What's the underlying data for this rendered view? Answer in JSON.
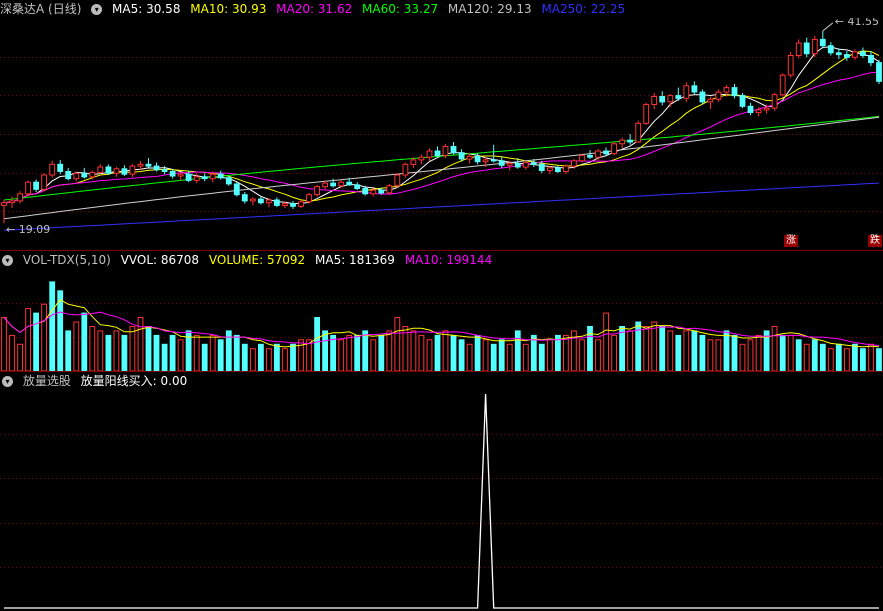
{
  "price_panel": {
    "title": "深桑达A (日线)",
    "indicators": [
      {
        "label": "MA5: 30.58",
        "color": "#ffffff"
      },
      {
        "label": "MA10: 30.93",
        "color": "#ffff00"
      },
      {
        "label": "MA20: 31.62",
        "color": "#ff00ff"
      },
      {
        "label": "MA60: 33.27",
        "color": "#00ff00"
      },
      {
        "label": "MA120: 29.13",
        "color": "#c0c0c0"
      },
      {
        "label": "MA250: 22.25",
        "color": "#3030ff"
      }
    ],
    "high_label": "41.55",
    "low_label": "19.09",
    "tag_rise": "涨",
    "tag_fall": "跌",
    "colors": {
      "up": "#ff3232",
      "down": "#54ffff"
    }
  },
  "volume_panel": {
    "title": "VOL-TDX(5,10)",
    "indicators": [
      {
        "label": "VVOL: 86708",
        "color": "#c0c0c0"
      },
      {
        "label": "VOLUME: 57092",
        "color": "#ffff00"
      },
      {
        "label": "MA5: 181369",
        "color": "#ffffff"
      },
      {
        "label": "MA10: 199144",
        "color": "#ff00ff"
      }
    ]
  },
  "signal_panel": {
    "title": "放量选股",
    "indicators": [
      {
        "label": "放量阳线买入: 0.00",
        "color": "#ffffff"
      }
    ]
  },
  "chart_data": [
    {
      "type": "candlestick",
      "ylim": [
        17,
        43
      ],
      "candles": [
        [
          22.0,
          22.6,
          20.0,
          22.3
        ],
        [
          22.3,
          23.0,
          21.7,
          22.5
        ],
        [
          22.5,
          23.6,
          22.2,
          23.3
        ],
        [
          23.3,
          24.8,
          23.0,
          24.6
        ],
        [
          24.6,
          24.9,
          23.5,
          23.8
        ],
        [
          23.8,
          25.6,
          23.6,
          25.4
        ],
        [
          25.4,
          27.0,
          25.1,
          26.6
        ],
        [
          26.6,
          27.1,
          25.5,
          25.8
        ],
        [
          25.8,
          26.2,
          24.8,
          25.0
        ],
        [
          25.0,
          25.8,
          24.7,
          25.6
        ],
        [
          25.6,
          26.2,
          25.0,
          25.2
        ],
        [
          25.2,
          25.9,
          24.9,
          25.7
        ],
        [
          25.7,
          26.6,
          25.5,
          26.3
        ],
        [
          26.3,
          26.6,
          25.4,
          25.6
        ],
        [
          25.6,
          26.3,
          25.2,
          26.1
        ],
        [
          26.1,
          26.5,
          25.3,
          25.5
        ],
        [
          25.5,
          26.6,
          25.2,
          26.4
        ],
        [
          26.4,
          27.0,
          26.0,
          26.6
        ],
        [
          26.6,
          27.3,
          26.2,
          26.4
        ],
        [
          26.4,
          26.8,
          25.8,
          26.0
        ],
        [
          26.0,
          26.4,
          25.5,
          25.8
        ],
        [
          25.8,
          26.1,
          25.0,
          25.3
        ],
        [
          25.3,
          25.7,
          24.8,
          25.5
        ],
        [
          25.5,
          25.9,
          24.6,
          24.8
        ],
        [
          24.8,
          25.6,
          24.5,
          25.2
        ],
        [
          25.2,
          25.6,
          24.7,
          25.0
        ],
        [
          25.0,
          25.8,
          24.6,
          25.5
        ],
        [
          25.5,
          25.9,
          24.9,
          25.1
        ],
        [
          25.1,
          25.3,
          24.2,
          24.4
        ],
        [
          24.4,
          24.6,
          23.0,
          23.2
        ],
        [
          23.2,
          23.5,
          22.2,
          22.5
        ],
        [
          22.5,
          22.9,
          22.0,
          22.7
        ],
        [
          22.7,
          23.0,
          22.1,
          22.3
        ],
        [
          22.3,
          22.8,
          21.8,
          22.6
        ],
        [
          22.6,
          22.9,
          21.8,
          22.0
        ],
        [
          22.0,
          22.4,
          21.7,
          22.2
        ],
        [
          22.2,
          22.5,
          21.6,
          21.9
        ],
        [
          21.9,
          22.6,
          21.7,
          22.4
        ],
        [
          22.4,
          23.4,
          22.2,
          23.2
        ],
        [
          23.2,
          24.3,
          23.0,
          24.1
        ],
        [
          24.1,
          24.8,
          23.8,
          24.5
        ],
        [
          24.5,
          25.0,
          24.0,
          24.2
        ],
        [
          24.2,
          24.8,
          24.0,
          24.6
        ],
        [
          24.6,
          25.1,
          24.2,
          24.3
        ],
        [
          24.3,
          24.6,
          23.7,
          23.9
        ],
        [
          23.9,
          24.2,
          23.1,
          23.3
        ],
        [
          23.3,
          23.9,
          23.0,
          23.7
        ],
        [
          23.7,
          24.0,
          23.2,
          23.4
        ],
        [
          23.4,
          24.4,
          23.2,
          24.2
        ],
        [
          24.2,
          25.6,
          24.0,
          25.4
        ],
        [
          25.4,
          26.8,
          25.1,
          26.6
        ],
        [
          26.6,
          27.4,
          26.2,
          27.1
        ],
        [
          27.1,
          27.7,
          26.6,
          27.4
        ],
        [
          27.4,
          28.4,
          27.0,
          28.1
        ],
        [
          28.1,
          28.6,
          27.3,
          27.6
        ],
        [
          27.6,
          28.9,
          27.3,
          28.6
        ],
        [
          28.6,
          29.1,
          27.7,
          27.9
        ],
        [
          27.9,
          28.3,
          26.9,
          27.2
        ],
        [
          27.2,
          27.9,
          26.7,
          27.5
        ],
        [
          27.5,
          27.8,
          26.6,
          26.9
        ],
        [
          26.9,
          27.4,
          26.3,
          27.1
        ],
        [
          27.1,
          28.8,
          26.8,
          27.0
        ],
        [
          27.0,
          27.5,
          26.2,
          26.5
        ],
        [
          26.5,
          27.0,
          25.9,
          26.7
        ],
        [
          26.7,
          27.3,
          26.1,
          26.3
        ],
        [
          26.3,
          27.0,
          26.0,
          26.8
        ],
        [
          26.8,
          27.2,
          26.3,
          26.6
        ],
        [
          26.6,
          27.0,
          25.6,
          25.9
        ],
        [
          25.9,
          26.4,
          25.5,
          26.2
        ],
        [
          26.2,
          26.5,
          25.6,
          25.8
        ],
        [
          25.8,
          26.6,
          25.5,
          26.4
        ],
        [
          26.4,
          27.2,
          26.1,
          27.0
        ],
        [
          27.0,
          27.8,
          26.8,
          27.6
        ],
        [
          27.6,
          28.2,
          27.2,
          27.4
        ],
        [
          27.4,
          28.3,
          27.1,
          28.1
        ],
        [
          28.1,
          28.5,
          27.5,
          27.8
        ],
        [
          27.8,
          29.1,
          27.6,
          28.9
        ],
        [
          28.9,
          29.6,
          28.4,
          29.3
        ],
        [
          29.3,
          30.0,
          28.8,
          29.1
        ],
        [
          29.1,
          31.5,
          29.0,
          31.2
        ],
        [
          31.2,
          33.5,
          31.0,
          33.3
        ],
        [
          33.3,
          34.6,
          32.8,
          34.2
        ],
        [
          34.2,
          34.8,
          33.2,
          33.6
        ],
        [
          33.6,
          34.5,
          33.0,
          34.3
        ],
        [
          34.3,
          35.2,
          33.7,
          34.0
        ],
        [
          34.0,
          35.8,
          33.6,
          35.4
        ],
        [
          35.4,
          35.9,
          34.4,
          34.7
        ],
        [
          34.7,
          35.0,
          33.3,
          33.6
        ],
        [
          33.6,
          34.2,
          32.8,
          33.9
        ],
        [
          33.9,
          35.0,
          33.6,
          34.7
        ],
        [
          34.7,
          35.5,
          34.2,
          35.2
        ],
        [
          35.2,
          35.6,
          34.0,
          34.3
        ],
        [
          34.3,
          34.6,
          32.9,
          33.1
        ],
        [
          33.1,
          33.5,
          32.1,
          32.4
        ],
        [
          32.4,
          33.0,
          32.0,
          32.7
        ],
        [
          32.7,
          33.3,
          32.3,
          32.9
        ],
        [
          32.9,
          34.6,
          32.6,
          34.4
        ],
        [
          34.4,
          36.8,
          34.2,
          36.6
        ],
        [
          36.6,
          39.2,
          36.3,
          38.8
        ],
        [
          38.8,
          40.6,
          38.5,
          40.2
        ],
        [
          40.2,
          40.8,
          38.6,
          39.0
        ],
        [
          39.0,
          41.0,
          38.6,
          40.6
        ],
        [
          40.6,
          41.55,
          39.6,
          39.9
        ],
        [
          39.9,
          40.3,
          38.8,
          39.1
        ],
        [
          39.1,
          39.6,
          38.4,
          38.9
        ],
        [
          38.9,
          39.3,
          38.2,
          38.6
        ],
        [
          38.6,
          39.5,
          38.3,
          39.2
        ],
        [
          39.2,
          39.7,
          38.5,
          38.8
        ],
        [
          38.8,
          39.3,
          37.6,
          38.0
        ],
        [
          38.0,
          38.3,
          35.6,
          35.9
        ]
      ],
      "volume": [
        [
          12,
          1
        ],
        [
          8,
          1
        ],
        [
          6,
          1
        ],
        [
          14,
          1
        ],
        [
          13,
          -1
        ],
        [
          15,
          1
        ],
        [
          20,
          -1
        ],
        [
          18,
          -1
        ],
        [
          9,
          -1
        ],
        [
          11,
          1
        ],
        [
          13,
          -1
        ],
        [
          10,
          1
        ],
        [
          9,
          1
        ],
        [
          8,
          -1
        ],
        [
          9,
          1
        ],
        [
          8,
          -1
        ],
        [
          10,
          1
        ],
        [
          12,
          1
        ],
        [
          10,
          -1
        ],
        [
          8,
          -1
        ],
        [
          6,
          -1
        ],
        [
          8,
          -1
        ],
        [
          7,
          1
        ],
        [
          9,
          -1
        ],
        [
          8,
          1
        ],
        [
          6,
          -1
        ],
        [
          8,
          1
        ],
        [
          7,
          -1
        ],
        [
          9,
          -1
        ],
        [
          8,
          -1
        ],
        [
          6,
          -1
        ],
        [
          5,
          1
        ],
        [
          6,
          -1
        ],
        [
          5,
          1
        ],
        [
          6,
          -1
        ],
        [
          5,
          1
        ],
        [
          6,
          -1
        ],
        [
          7,
          1
        ],
        [
          7,
          1
        ],
        [
          12,
          -1
        ],
        [
          9,
          -1
        ],
        [
          8,
          -1
        ],
        [
          7,
          1
        ],
        [
          8,
          1
        ],
        [
          8,
          -1
        ],
        [
          9,
          -1
        ],
        [
          7,
          1
        ],
        [
          8,
          -1
        ],
        [
          9,
          1
        ],
        [
          12,
          1
        ],
        [
          10,
          1
        ],
        [
          9,
          1
        ],
        [
          8,
          1
        ],
        [
          7,
          1
        ],
        [
          8,
          -1
        ],
        [
          9,
          1
        ],
        [
          8,
          -1
        ],
        [
          7,
          -1
        ],
        [
          6,
          1
        ],
        [
          8,
          -1
        ],
        [
          7,
          1
        ],
        [
          6,
          -1
        ],
        [
          7,
          -1
        ],
        [
          6,
          1
        ],
        [
          9,
          -1
        ],
        [
          6,
          1
        ],
        [
          8,
          -1
        ],
        [
          6,
          -1
        ],
        [
          7,
          1
        ],
        [
          8,
          -1
        ],
        [
          8,
          1
        ],
        [
          9,
          1
        ],
        [
          7,
          1
        ],
        [
          10,
          -1
        ],
        [
          7,
          1
        ],
        [
          13,
          1
        ],
        [
          8,
          1
        ],
        [
          10,
          -1
        ],
        [
          9,
          1
        ],
        [
          11,
          -1
        ],
        [
          10,
          1
        ],
        [
          11,
          1
        ],
        [
          10,
          -1
        ],
        [
          9,
          1
        ],
        [
          8,
          -1
        ],
        [
          9,
          1
        ],
        [
          9,
          -1
        ],
        [
          8,
          -1
        ],
        [
          7,
          1
        ],
        [
          7,
          1
        ],
        [
          9,
          -1
        ],
        [
          8,
          -1
        ],
        [
          6,
          1
        ],
        [
          7,
          1
        ],
        [
          8,
          1
        ],
        [
          9,
          -1
        ],
        [
          10,
          1
        ],
        [
          8,
          -1
        ],
        [
          8,
          1
        ],
        [
          7,
          -1
        ],
        [
          6,
          1
        ],
        [
          7,
          -1
        ],
        [
          6,
          -1
        ],
        [
          5,
          1
        ],
        [
          6,
          -1
        ],
        [
          5,
          1
        ],
        [
          6,
          -1
        ],
        [
          5,
          -1
        ],
        [
          6,
          1
        ],
        [
          5,
          -1
        ]
      ],
      "signal": {
        "index": 60,
        "value": 1
      }
    }
  ]
}
